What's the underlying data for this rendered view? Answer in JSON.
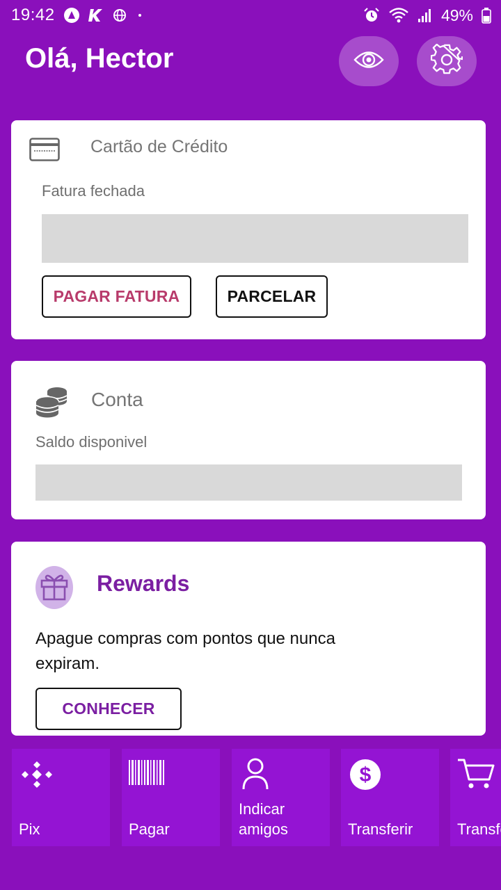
{
  "status_bar": {
    "time": "19:42",
    "battery": "49%"
  },
  "header": {
    "greeting": "Olá, Hector",
    "eye_icon": "eye-icon",
    "settings_icon": "gear-icon"
  },
  "credit_card": {
    "title": "Cartão de Crédito",
    "subtitle": "Fatura fechada",
    "pay_button": "PAGAR FATURA",
    "installment_button": "PARCELAR",
    "pay_color": "#b83b6b"
  },
  "account": {
    "title": "Conta",
    "subtitle": "Saldo disponivel"
  },
  "rewards": {
    "title": "Rewards",
    "text": "Apague compras com pontos que nunca expiram.",
    "button": "CONHECER",
    "accent": "#7b1fa2"
  },
  "shortcuts": [
    {
      "label": "Pix",
      "icon": "pix-icon"
    },
    {
      "label": "Pagar",
      "icon": "barcode-icon"
    },
    {
      "label": "Indicar amigos",
      "icon": "person-icon"
    },
    {
      "label": "Transferir",
      "icon": "dollar-icon"
    },
    {
      "label": "Transferir",
      "icon": "cart-icon"
    }
  ],
  "colors": {
    "background": "#8a10bb",
    "shortcut_tile": "#9414d3",
    "card": "#ffffff"
  }
}
